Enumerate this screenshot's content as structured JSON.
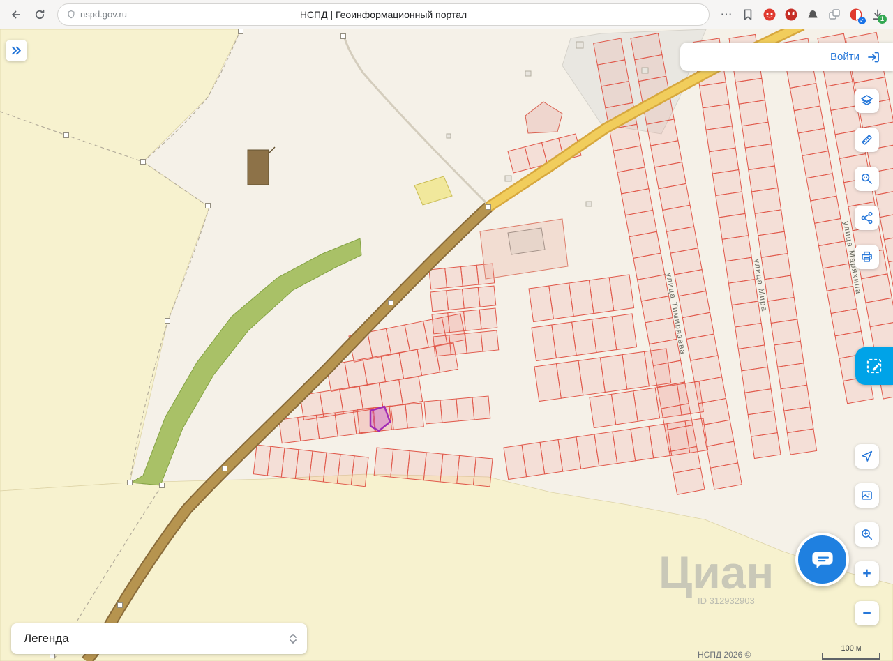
{
  "browser": {
    "url": "nspd.gov.ru",
    "page_title": "НСПД | Геоинформационный портал",
    "download_badge": "1"
  },
  "header": {
    "login_label": "Войти"
  },
  "legend": {
    "label": "Легенда"
  },
  "map": {
    "attribution": "НСПД 2026 ©",
    "scale_label": "100 м",
    "watermark": "Циан",
    "watermark_id": "ID 312932903",
    "streets": {
      "timiryazeva": "улица Тимирязева",
      "mira": "улица Мира",
      "maryakhina": "улица Маряхина"
    }
  },
  "controls": {
    "zoom_in": "+",
    "zoom_out": "−"
  },
  "colors": {
    "accent_blue": "#2677d9",
    "active_tool": "#00a3e8",
    "parcel_stroke": "#e0584a",
    "selected_parcel": "#a22cb4",
    "field_yellow": "#f7f2cf",
    "green_area": "#a9c167",
    "road_brown": "#b6944f"
  }
}
